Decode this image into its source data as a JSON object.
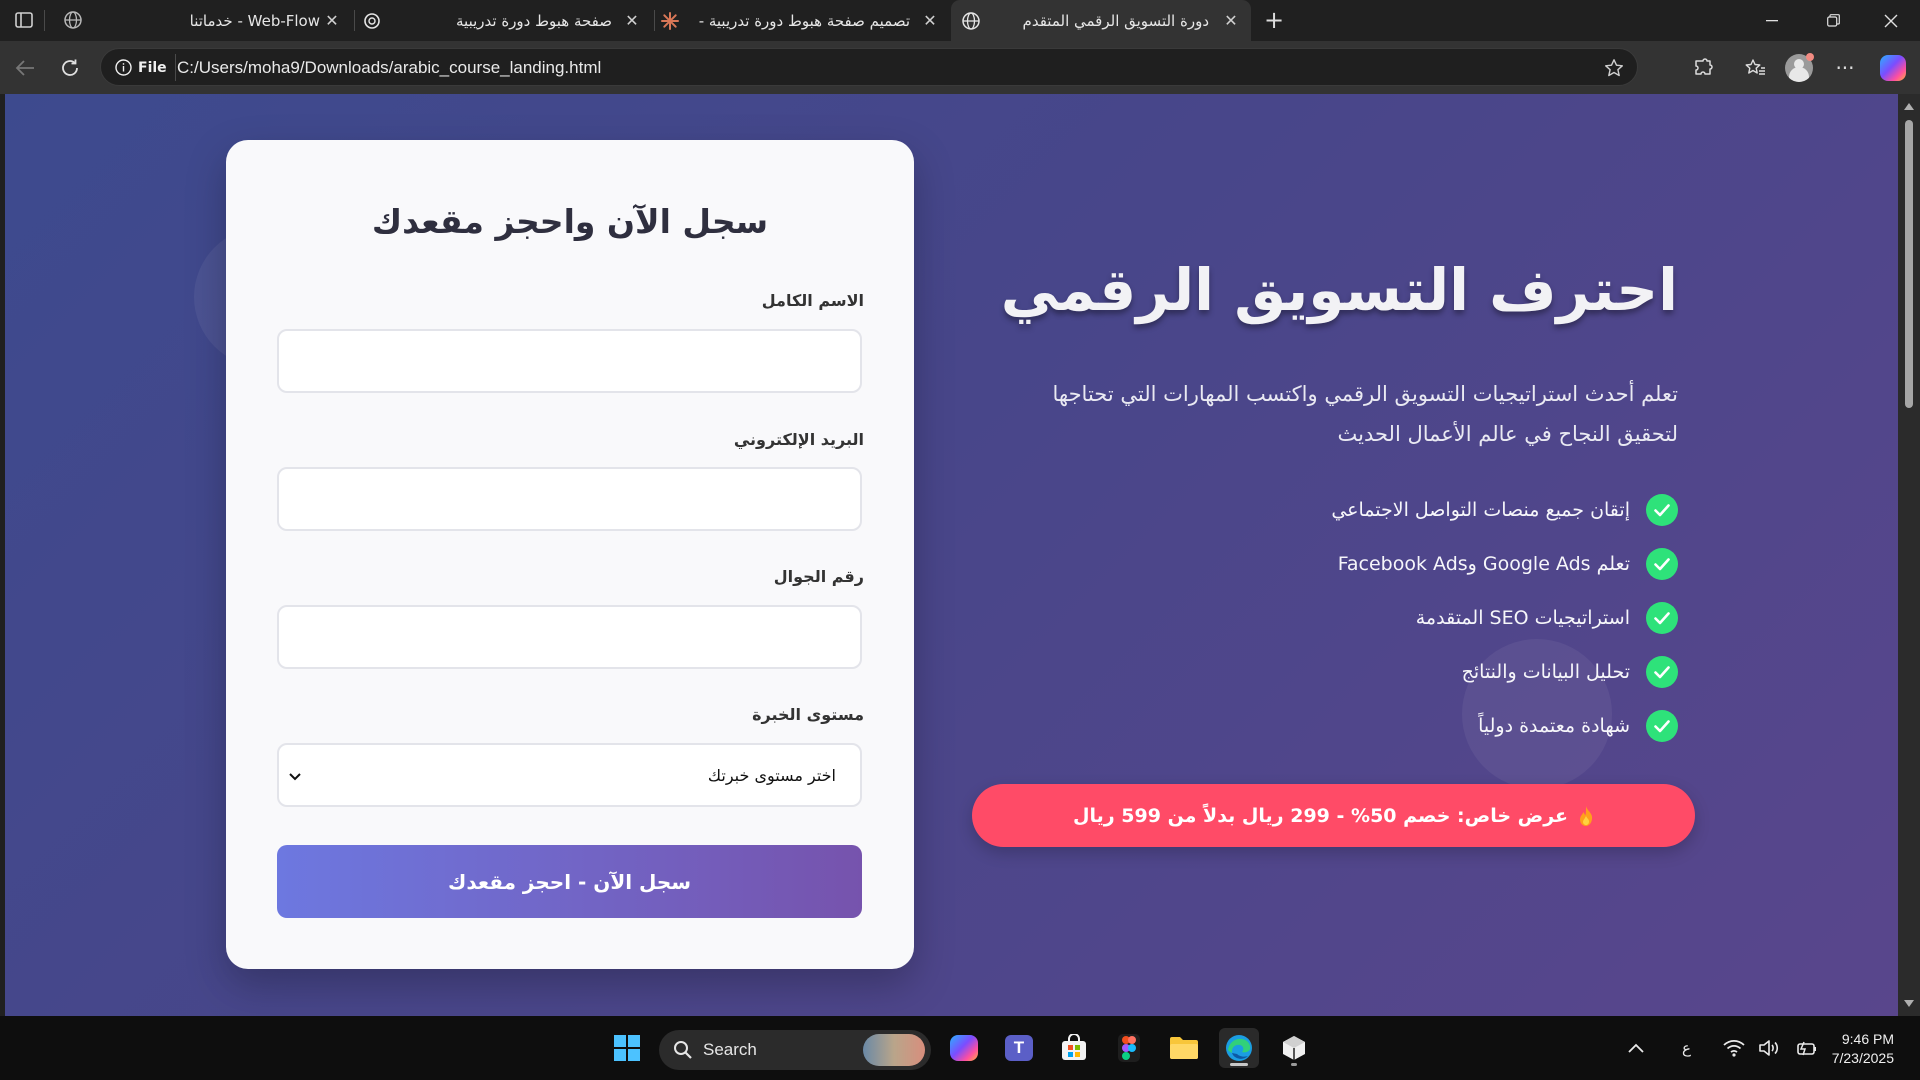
{
  "browser": {
    "tabs": [
      {
        "title": "Web-Flow - خدماتنا",
        "favicon": "globe-icon",
        "active": false
      },
      {
        "title": "صفحة هبوط دورة تدريبية",
        "favicon": "chatgpt-icon",
        "active": false
      },
      {
        "title": "تصميم صفحة هبوط دورة تدريبية -",
        "favicon": "claude-icon",
        "active": false
      },
      {
        "title": "دورة التسويق الرقمي المتقدم",
        "favicon": "globe-icon",
        "active": true
      }
    ],
    "address": {
      "scheme_label": "File",
      "url": "C:/Users/moha9/Downloads/arabic_course_landing.html"
    }
  },
  "page": {
    "form": {
      "title": "سجل الآن واحجز مقعدك",
      "fields": [
        {
          "label": "الاسم الكامل",
          "value": ""
        },
        {
          "label": "البريد الإلكتروني",
          "value": ""
        },
        {
          "label": "رقم الجوال",
          "value": ""
        }
      ],
      "experience": {
        "label": "مستوى الخبرة",
        "selected": "اختر مستوى خبرتك"
      },
      "submit_label": "سجل الآن - احجز مقعدك"
    },
    "hero": {
      "title": "احترف التسويق الرقمي",
      "description": "تعلم أحدث استراتيجيات التسويق الرقمي واكتسب المهارات التي تحتاجها لتحقيق النجاح في عالم الأعمال الحديث",
      "features": [
        "إتقان جميع منصات التواصل الاجتماعي",
        "تعلم Google Ads وFacebook Ads",
        "استراتيجيات SEO المتقدمة",
        "تحليل البيانات والنتائج",
        "شهادة معتمدة دولياً"
      ],
      "offer": "عرض خاص: خصم 50% - 299 ريال بدلاً من 599 ريال"
    },
    "colors": {
      "background_start": "#3d4a8e",
      "background_end": "#59468c",
      "check_green": "#2ee27a",
      "offer_red": "#ff4b67",
      "button_start": "#6d78e0",
      "button_end": "#7653ad"
    }
  },
  "taskbar": {
    "search_label": "Search",
    "input_indicator": "ع",
    "time": "9:46 PM",
    "date": "7/23/2025",
    "apps": [
      "windows-start-icon",
      "copilot-icon",
      "teams-icon",
      "microsoft-store-icon",
      "figma-icon",
      "file-explorer-icon",
      "edge-icon",
      "app-icon"
    ]
  }
}
